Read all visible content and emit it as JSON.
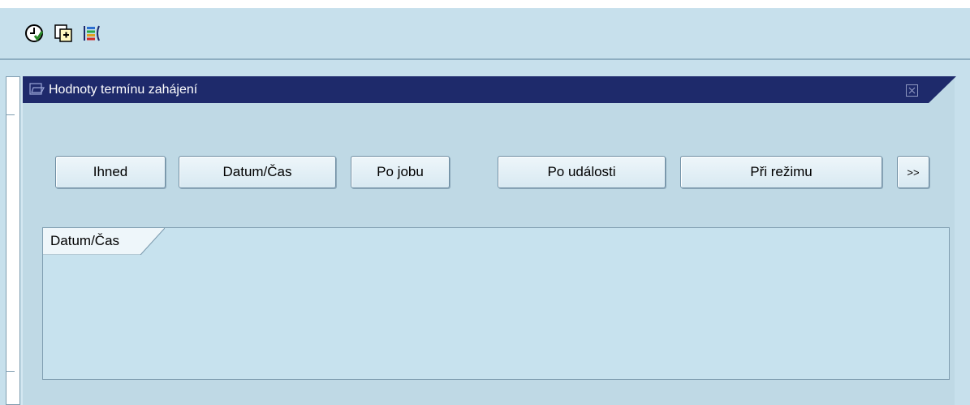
{
  "toolbar": {
    "buttons": [
      {
        "icon": "clock-check-icon"
      },
      {
        "icon": "copy-document-icon"
      },
      {
        "icon": "color-bars-icon"
      }
    ]
  },
  "dialog": {
    "title": "Hodnoty termínu zahájení",
    "close_icon": "close-icon",
    "buttons": {
      "immediately": "Ihned",
      "date_time": "Datum/Čas",
      "after_job": "Po jobu",
      "after_event": "Po události",
      "at_operation_mode": "Při režimu",
      "more": ">>"
    },
    "group": {
      "label": "Datum/Čas"
    }
  },
  "colors": {
    "background": "#c7e0ec",
    "title_bar": "#1e2a6b",
    "dialog": "#bfd9e5"
  }
}
